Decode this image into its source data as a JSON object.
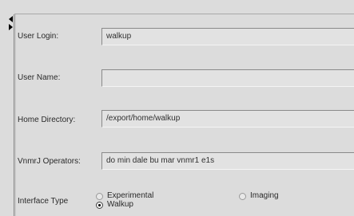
{
  "form": {
    "user_login": {
      "label": "User Login:",
      "value": "walkup"
    },
    "user_name": {
      "label": "User Name:",
      "value": ""
    },
    "home_directory": {
      "label": "Home Directory:",
      "value": "/export/home/walkup"
    },
    "operators": {
      "label": "VnmrJ Operators:",
      "value": "do min  dale bu mar vnmr1  e1s"
    },
    "interface_type": {
      "label": "Interface Type",
      "options": [
        {
          "label": "Experimental",
          "selected": false
        },
        {
          "label": "Walkup",
          "selected": true
        },
        {
          "label": "Imaging",
          "selected": false
        }
      ]
    }
  },
  "icons": {
    "splitter": "left-right-arrows-icon"
  }
}
